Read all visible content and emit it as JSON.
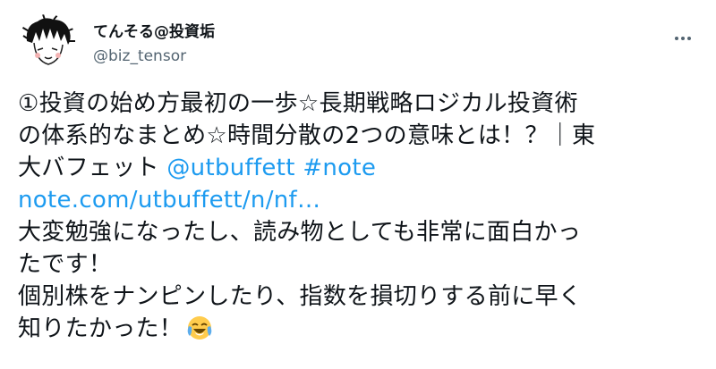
{
  "user": {
    "display_name": "てんそる@投資垢",
    "handle": "@biz_tensor",
    "avatar_icon": "hand-drawn-face-avatar"
  },
  "menu": {
    "more_icon": "more-horizontal-icon"
  },
  "tweet": {
    "line1": "①投資の始め方最初の一歩☆長期戦略ロジカル投資術",
    "line2": "の体系的なまとめ☆時間分散の2つの意味とは！？｜東",
    "line3_text": "大バフェット ",
    "mention": "@utbuffett",
    "hashtag": "#note",
    "url": "note.com/utbuffett/n/nf…",
    "line5": "大変勉強になったし、読み物としても非常に面白かっ",
    "line6": "たです！",
    "line7": "個別株をナンピンしたり、指数を損切りする前に早く",
    "line8": "知りたかった！",
    "emoji_icon": "face-with-tears-of-joy-icon"
  },
  "colors": {
    "link": "#1d9bf0",
    "text": "#0f1419",
    "secondary": "#536471"
  }
}
